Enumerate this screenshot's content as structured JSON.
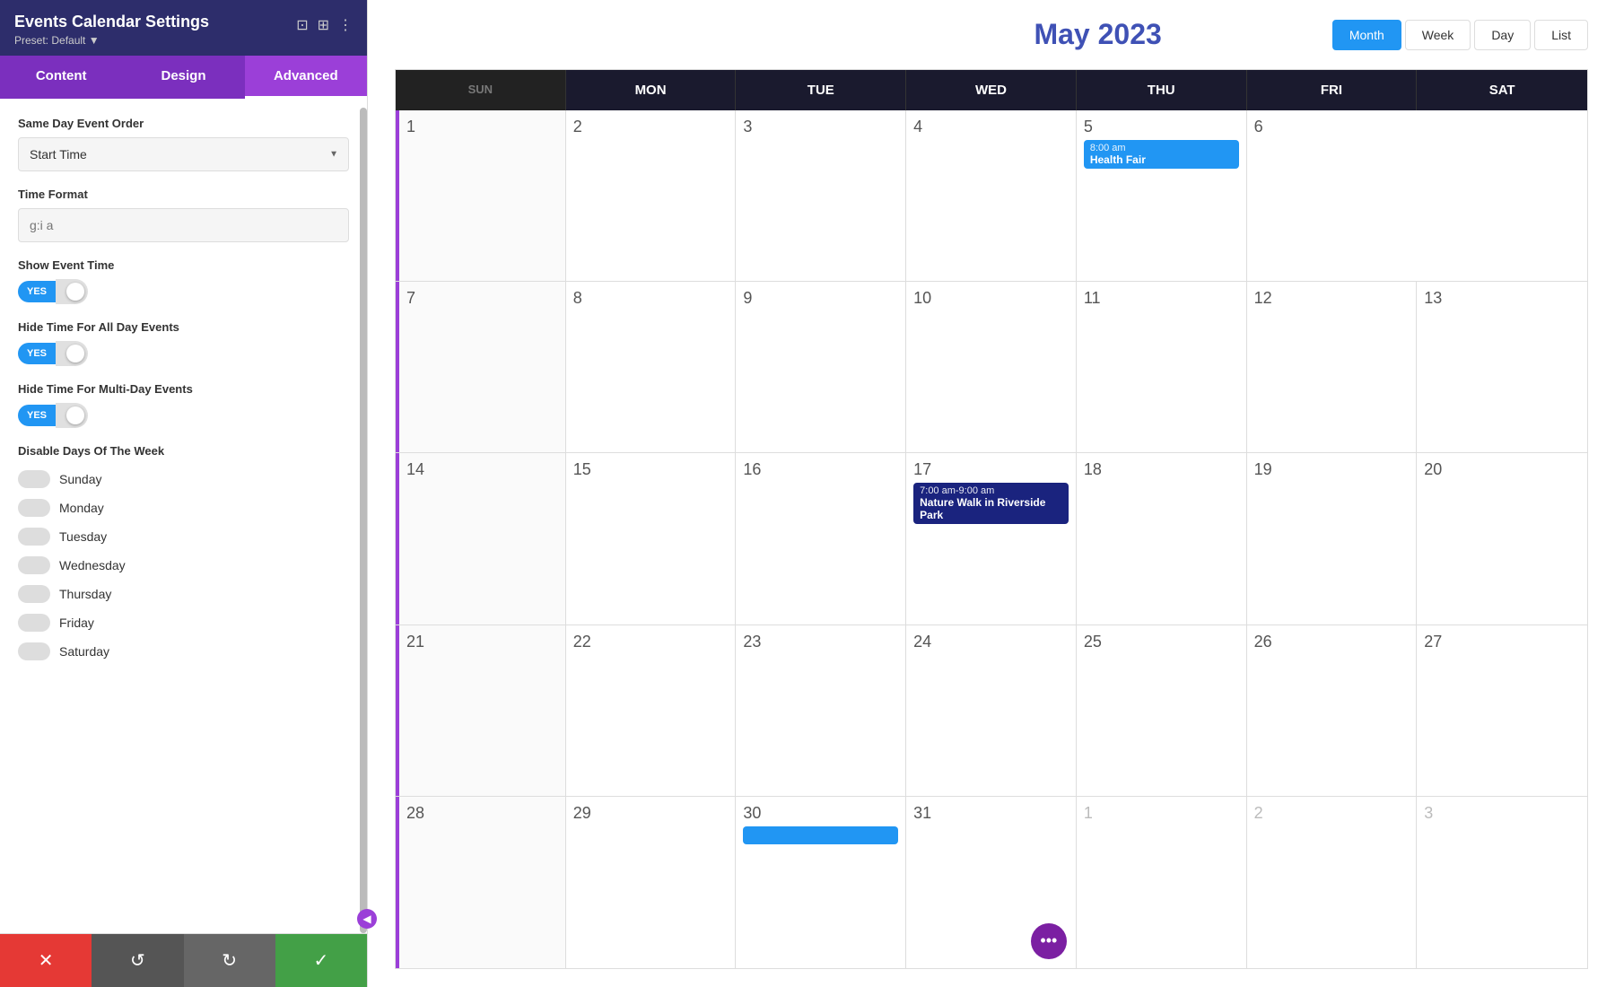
{
  "panel": {
    "title": "Events Calendar Settings",
    "subtitle": "Preset: Default ▼",
    "tabs": [
      {
        "label": "Content",
        "active": false
      },
      {
        "label": "Design",
        "active": false
      },
      {
        "label": "Advanced",
        "active": true
      }
    ],
    "fields": {
      "same_day_event_order": {
        "label": "Same Day Event Order",
        "value": "Start Time"
      },
      "time_format": {
        "label": "Time Format",
        "placeholder": "g:i a"
      },
      "show_event_time": {
        "label": "Show Event Time",
        "value": "YES"
      },
      "hide_time_all_day": {
        "label": "Hide Time For All Day Events",
        "value": "YES"
      },
      "hide_time_multi_day": {
        "label": "Hide Time For Multi-Day Events",
        "value": "YES"
      },
      "disable_days_label": "Disable Days Of The Week",
      "days": [
        "Sunday",
        "Monday",
        "Tuesday",
        "Wednesday",
        "Thursday",
        "Friday",
        "Saturday"
      ]
    },
    "toolbar": {
      "cancel_label": "✕",
      "undo_label": "↺",
      "redo_label": "↻",
      "save_label": "✓"
    }
  },
  "calendar": {
    "title": "May 2023",
    "view_buttons": [
      {
        "label": "Month",
        "active": true
      },
      {
        "label": "Week",
        "active": false
      },
      {
        "label": "Day",
        "active": false
      },
      {
        "label": "List",
        "active": false
      }
    ],
    "day_headers": [
      "MON",
      "TUE",
      "WED",
      "THU",
      "FRI",
      "SAT"
    ],
    "weeks": [
      {
        "cells": [
          {
            "number": "2",
            "other_month": false,
            "events": []
          },
          {
            "number": "3",
            "other_month": false,
            "events": []
          },
          {
            "number": "4",
            "other_month": false,
            "events": []
          },
          {
            "number": "5",
            "other_month": false,
            "events": [
              {
                "time": "8:00 am",
                "name": "Health Fair",
                "color": "blue"
              }
            ]
          },
          {
            "number": "6",
            "other_month": false,
            "events": []
          }
        ]
      },
      {
        "cells": [
          {
            "number": "8",
            "other_month": false,
            "events": [],
            "partial": true
          },
          {
            "number": "9",
            "other_month": false,
            "events": []
          },
          {
            "number": "10",
            "other_month": false,
            "events": []
          },
          {
            "number": "11",
            "other_month": false,
            "events": []
          },
          {
            "number": "12",
            "other_month": false,
            "events": []
          },
          {
            "number": "13",
            "other_month": false,
            "events": []
          }
        ]
      },
      {
        "cells": [
          {
            "number": "15",
            "other_month": false,
            "events": [],
            "partial": true
          },
          {
            "number": "16",
            "other_month": false,
            "events": []
          },
          {
            "number": "17",
            "other_month": false,
            "events": [
              {
                "time": "7:00 am-9:00 am",
                "name": "Nature Walk in Riverside Park",
                "color": "darkblue"
              }
            ]
          },
          {
            "number": "18",
            "other_month": false,
            "events": []
          },
          {
            "number": "19",
            "other_month": false,
            "events": []
          },
          {
            "number": "20",
            "other_month": false,
            "events": []
          }
        ]
      },
      {
        "cells": [
          {
            "number": "22",
            "other_month": false,
            "events": [],
            "partial": true
          },
          {
            "number": "23",
            "other_month": false,
            "events": []
          },
          {
            "number": "24",
            "other_month": false,
            "events": []
          },
          {
            "number": "25",
            "other_month": false,
            "events": []
          },
          {
            "number": "26",
            "other_month": false,
            "events": []
          },
          {
            "number": "27",
            "other_month": false,
            "events": []
          }
        ]
      },
      {
        "cells": [
          {
            "number": "29",
            "other_month": false,
            "events": [],
            "partial": true
          },
          {
            "number": "30",
            "other_month": false,
            "events": [
              {
                "time": "",
                "name": "...",
                "color": "blue",
                "pill_only": true
              }
            ]
          },
          {
            "number": "31",
            "other_month": false,
            "events": [],
            "has_dots": true
          },
          {
            "number": "1",
            "other_month": true,
            "events": []
          },
          {
            "number": "2",
            "other_month": true,
            "events": []
          },
          {
            "number": "3",
            "other_month": true,
            "events": []
          }
        ]
      }
    ],
    "events": {
      "health_fair": {
        "time": "8:00 am",
        "name": "Health Fair"
      },
      "nature_walk": {
        "time": "7:00 am-9:00 am",
        "name": "Nature Walk in Riverside Park"
      }
    }
  }
}
